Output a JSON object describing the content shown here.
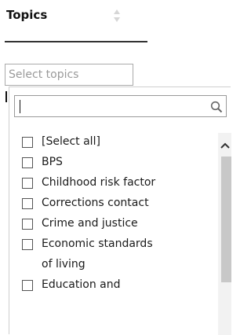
{
  "header": {
    "title": "Topics",
    "sort_icon": "sort-arrows-icon"
  },
  "filter": {
    "placeholder": "Select topics"
  },
  "dropdown": {
    "search": {
      "value": "",
      "icon": "search-icon"
    },
    "items": [
      {
        "label": "[Select all]",
        "checked": false
      },
      {
        "label": "BPS",
        "checked": false
      },
      {
        "label": "Childhood risk factor",
        "checked": false
      },
      {
        "label": "Corrections contact",
        "checked": false
      },
      {
        "label": "Crime and justice",
        "checked": false
      },
      {
        "label": "Economic standards",
        "label2": "of living",
        "checked": false
      },
      {
        "label": "Education and",
        "checked": false
      }
    ]
  },
  "colors": {
    "border": "#aaaaaa",
    "text": "#1a1a1a",
    "placeholder": "#9a9a9a",
    "scroll_thumb": "#c8c8c8"
  }
}
